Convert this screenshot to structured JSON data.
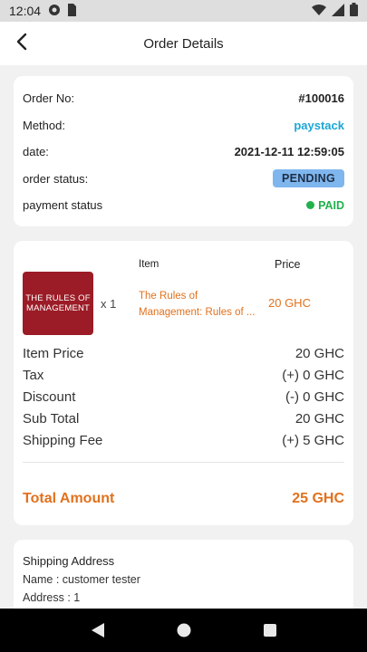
{
  "status_bar": {
    "time": "12:04"
  },
  "appbar": {
    "title": "Order Details"
  },
  "order": {
    "rows": [
      {
        "label": "Order No:",
        "value": "#100016"
      },
      {
        "label": "Method:",
        "value": "paystack"
      },
      {
        "label": "date:",
        "value": "2021-12-11 12:59:05"
      },
      {
        "label": "order status:",
        "value": "PENDING"
      },
      {
        "label": "payment status",
        "value": "PAID"
      }
    ]
  },
  "items": {
    "header_item": "Item",
    "header_price": "Price",
    "product": {
      "cover_text": "THE RULES OF MANAGEMENT",
      "quantity": "x 1",
      "name": "The Rules of Management: Rules of ...",
      "price": "20 GHC"
    },
    "summary": [
      {
        "label": "Item Price",
        "value": "20 GHC"
      },
      {
        "label": "Tax",
        "value": "(+) 0 GHC"
      },
      {
        "label": "Discount",
        "value": "(-) 0 GHC"
      },
      {
        "label": "Sub Total",
        "value": "20 GHC"
      },
      {
        "label": "Shipping Fee",
        "value": "(+) 5 GHC"
      }
    ],
    "total_label": "Total Amount",
    "total_value": "25 GHC"
  },
  "shipping": {
    "heading": "Shipping Address",
    "name": "Name : customer tester",
    "address": "Address : 1"
  },
  "colors": {
    "accent": "#e2711d",
    "paystack": "#1ba6d6",
    "paid": "#22b14c",
    "pending_bg": "#7fb6ee"
  },
  "icons": [
    "cloud-icon",
    "sim-card-icon",
    "wifi-icon",
    "signal-icon",
    "battery-icon",
    "back-arrow-icon",
    "nav-back-icon",
    "nav-home-icon",
    "nav-recents-icon"
  ]
}
